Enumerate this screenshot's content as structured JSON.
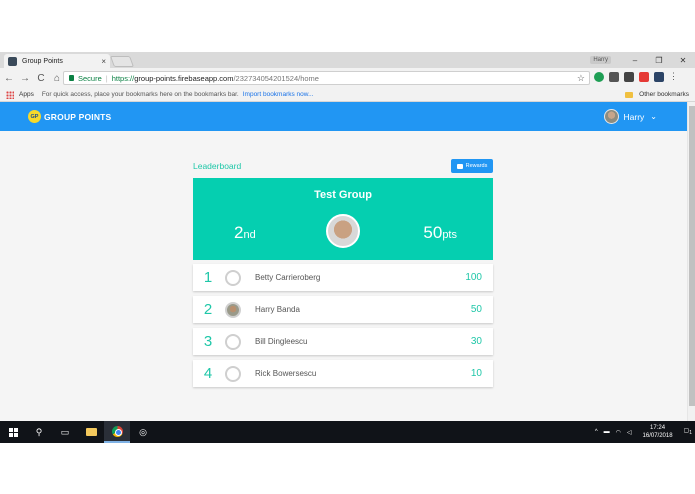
{
  "browser": {
    "tab_title": "Group Points",
    "tab_close": "×",
    "profile_chip": "Harry",
    "window_controls": {
      "minimize": "–",
      "maximize": "❐",
      "close": "✕"
    },
    "nav": {
      "back": "←",
      "forward": "→",
      "reload": "C",
      "home": "⌂"
    },
    "omnibox": {
      "secure_label": "Secure",
      "url_scheme": "https://",
      "url_host": "group-points.firebaseapp.com",
      "url_path": "/232734054201524/home"
    },
    "star": "☆",
    "bookmarks": {
      "apps_label": "Apps",
      "hint": "For quick access, place your bookmarks here on the bookmarks bar.",
      "import_link": "Import bookmarks now...",
      "other_label": "Other bookmarks"
    },
    "extension_colors": [
      "#1e9e54",
      "#555555",
      "#444444",
      "#e53935",
      "#2c4466"
    ]
  },
  "app": {
    "brand_badge": "GP",
    "brand_name": "GROUP POINTS",
    "user_name": "Harry",
    "user_chevron": "⌄",
    "accent": "#2196f3",
    "teal": "#05cfb0"
  },
  "leaderboard": {
    "title": "Leaderboard",
    "rewards_label": "Rewards",
    "group": {
      "name": "Test Group",
      "rank_number": "2",
      "rank_suffix": "nd",
      "points_number": "50",
      "points_suffix": "pts"
    },
    "rows": [
      {
        "position": "1",
        "name": "Betty Carrieroberg",
        "points": "100",
        "avatar": "placeholder"
      },
      {
        "position": "2",
        "name": "Harry Banda",
        "points": "50",
        "avatar": "photo"
      },
      {
        "position": "3",
        "name": "Bill Dingleescu",
        "points": "30",
        "avatar": "placeholder"
      },
      {
        "position": "4",
        "name": "Rick Bowersescu",
        "points": "10",
        "avatar": "placeholder"
      }
    ]
  },
  "taskbar": {
    "search_glyph": "⚲",
    "taskview_glyph": "▭",
    "target_glyph": "◎",
    "tray_up": "^",
    "time": "17:24",
    "date": "16/07/2018",
    "notification_count": "1"
  }
}
